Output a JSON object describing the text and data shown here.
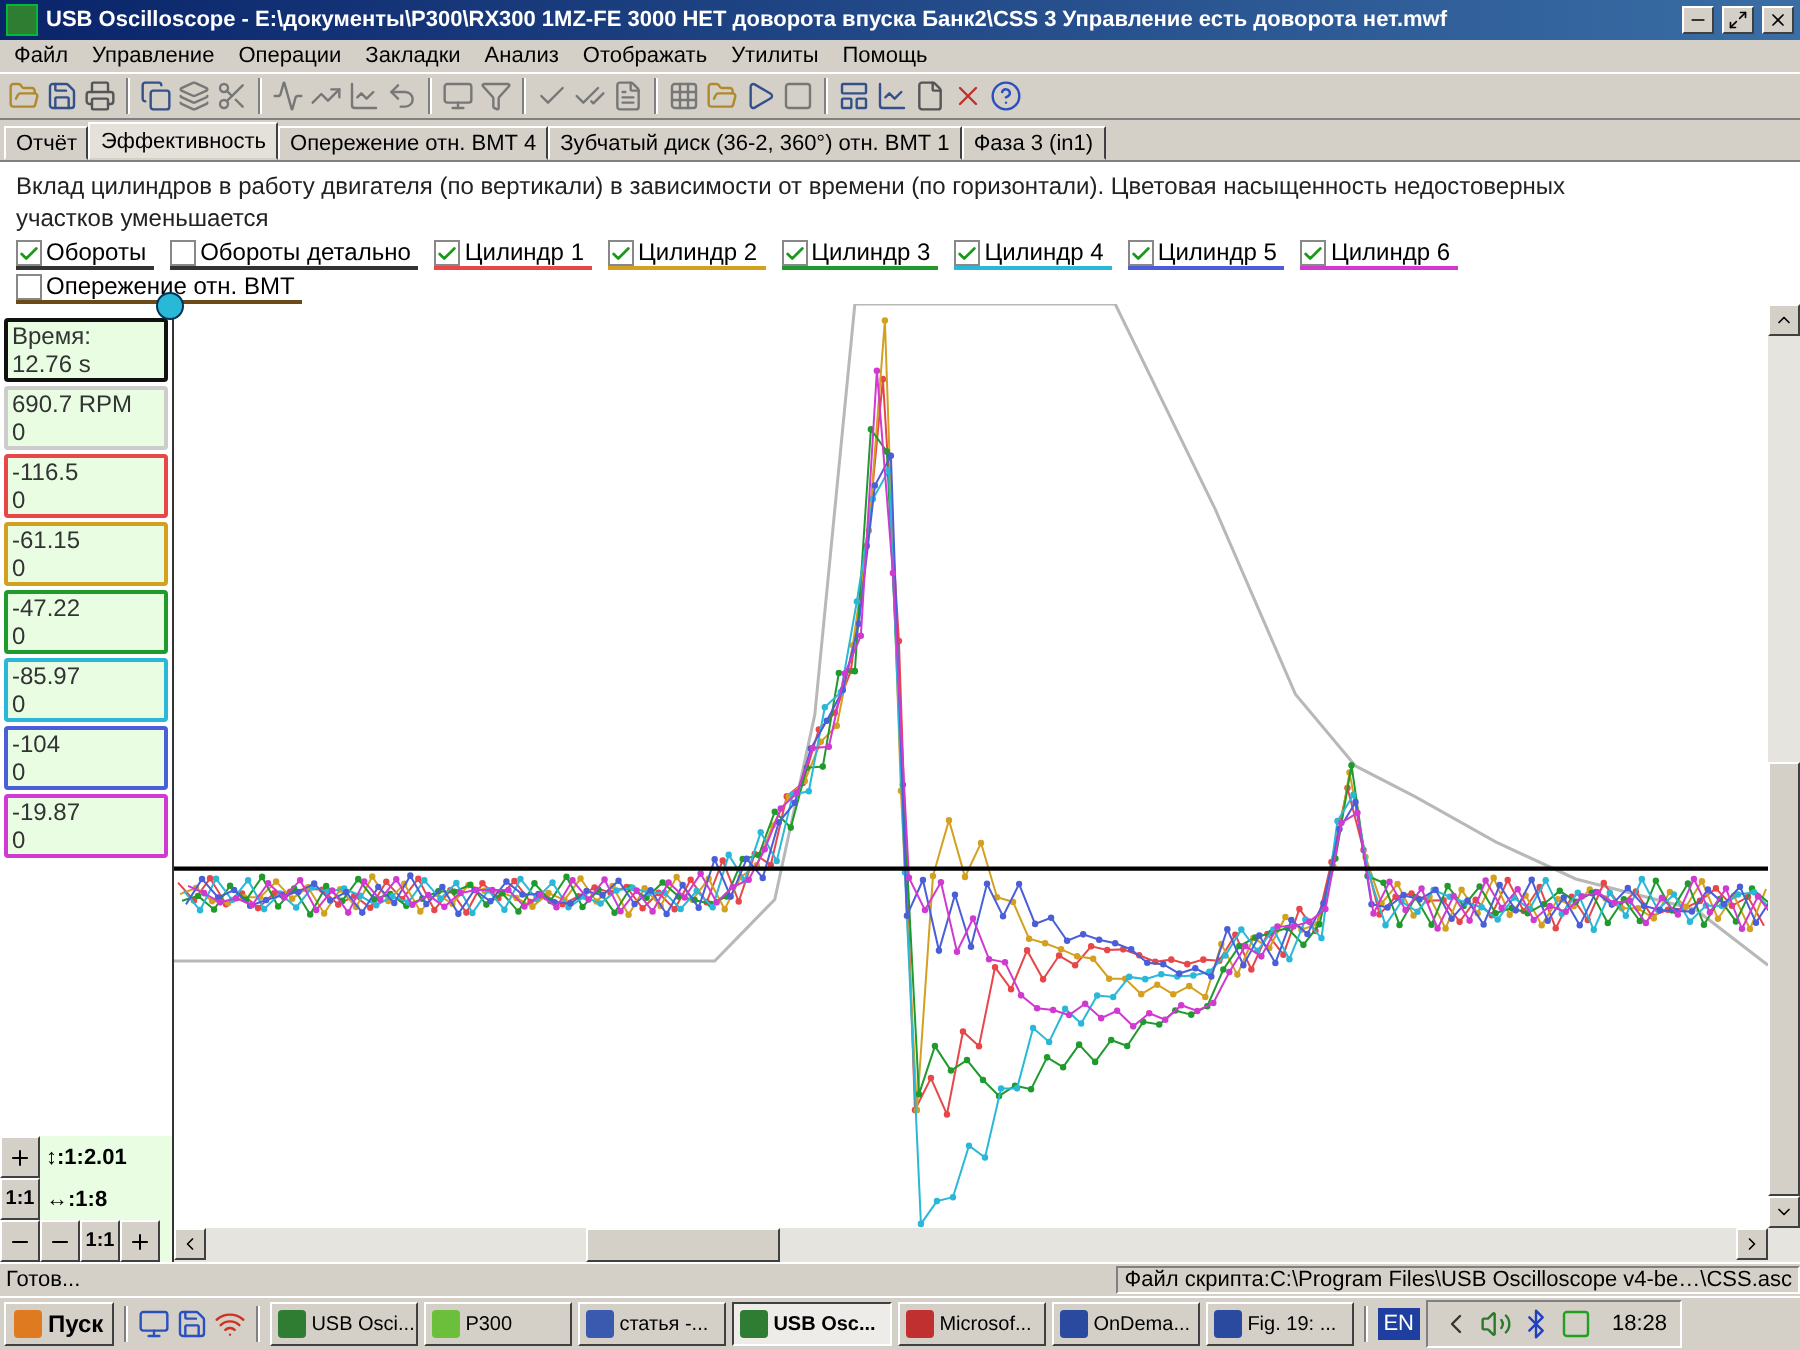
{
  "window": {
    "title": "USB Oscilloscope - E:\\документы\\P300\\RX300 1MZ-FE 3000 НЕТ доворота впуска Банк2\\CSS 3 Управление есть доворота нет.mwf"
  },
  "menu": [
    "Файл",
    "Управление",
    "Операции",
    "Закладки",
    "Анализ",
    "Отображать",
    "Утилиты",
    "Помощь"
  ],
  "tabs": [
    {
      "label": "Отчёт",
      "selected": false
    },
    {
      "label": "Эффективность",
      "selected": true
    },
    {
      "label": "Опережение отн. ВМТ 4",
      "selected": false
    },
    {
      "label": "Зубчатый диск (36-2, 360°) отн. ВМТ 1",
      "selected": false
    },
    {
      "label": "Фаза 3 (in1)",
      "selected": false
    }
  ],
  "description": "Вклад цилиндров в работу двигателя (по вертикали) в зависимости от времени (по горизонтали). Цветовая насыщенность недостоверных участков уменьшается",
  "channels": [
    {
      "label": "Обороты",
      "checked": true,
      "color": "#333333"
    },
    {
      "label": "Обороты детально",
      "checked": false,
      "color": "#333333"
    },
    {
      "label": "Цилиндр 1",
      "checked": true,
      "color": "#e8474a"
    },
    {
      "label": "Цилиндр 2",
      "checked": true,
      "color": "#d4a020"
    },
    {
      "label": "Цилиндр 3",
      "checked": true,
      "color": "#1f9a2c"
    },
    {
      "label": "Цилиндр 4",
      "checked": true,
      "color": "#2ab8d8"
    },
    {
      "label": "Цилиндр 5",
      "checked": true,
      "color": "#4a5ed8"
    },
    {
      "label": "Цилиндр 6",
      "checked": true,
      "color": "#d03ad0"
    },
    {
      "label": "Опережение отн. ВМТ",
      "checked": false,
      "color": "#6b4a1a"
    }
  ],
  "readouts": [
    {
      "line1": "Время:",
      "line2": "12.76 s",
      "color": "#111111"
    },
    {
      "line1": "690.7 RPM",
      "line2": "0",
      "color": "#cccccc"
    },
    {
      "line1": "-116.5",
      "line2": "0",
      "color": "#e8474a"
    },
    {
      "line1": "-61.15",
      "line2": "0",
      "color": "#d4a020"
    },
    {
      "line1": "-47.22",
      "line2": "0",
      "color": "#1f9a2c"
    },
    {
      "line1": "-85.97",
      "line2": "0",
      "color": "#2ab8d8"
    },
    {
      "line1": "-104",
      "line2": "0",
      "color": "#4a5ed8"
    },
    {
      "line1": "-19.87",
      "line2": "0",
      "color": "#d03ad0"
    }
  ],
  "scale": {
    "vertical": "↕:1:2.01",
    "horizontal": "↔:1:8",
    "reset_vertical": "1:1",
    "reset_horizontal": "1:1"
  },
  "status_bar": {
    "message": "Готов...",
    "script": "Файл скрипта:C:\\Program Files\\USB Oscilloscope v4-be…\\CSS.asc"
  },
  "taskbar": {
    "start": "Пуск",
    "tasks": [
      {
        "label": "USB Osci...",
        "selected": false
      },
      {
        "label": "P300",
        "selected": false
      },
      {
        "label": "статья -...",
        "selected": false
      },
      {
        "label": "USB Osc...",
        "selected": true
      },
      {
        "label": "Microsof...",
        "selected": false
      },
      {
        "label": "OnDema...",
        "selected": false
      },
      {
        "label": "Fig. 19: ...",
        "selected": false
      }
    ],
    "language": "EN",
    "clock": "18:28"
  }
}
